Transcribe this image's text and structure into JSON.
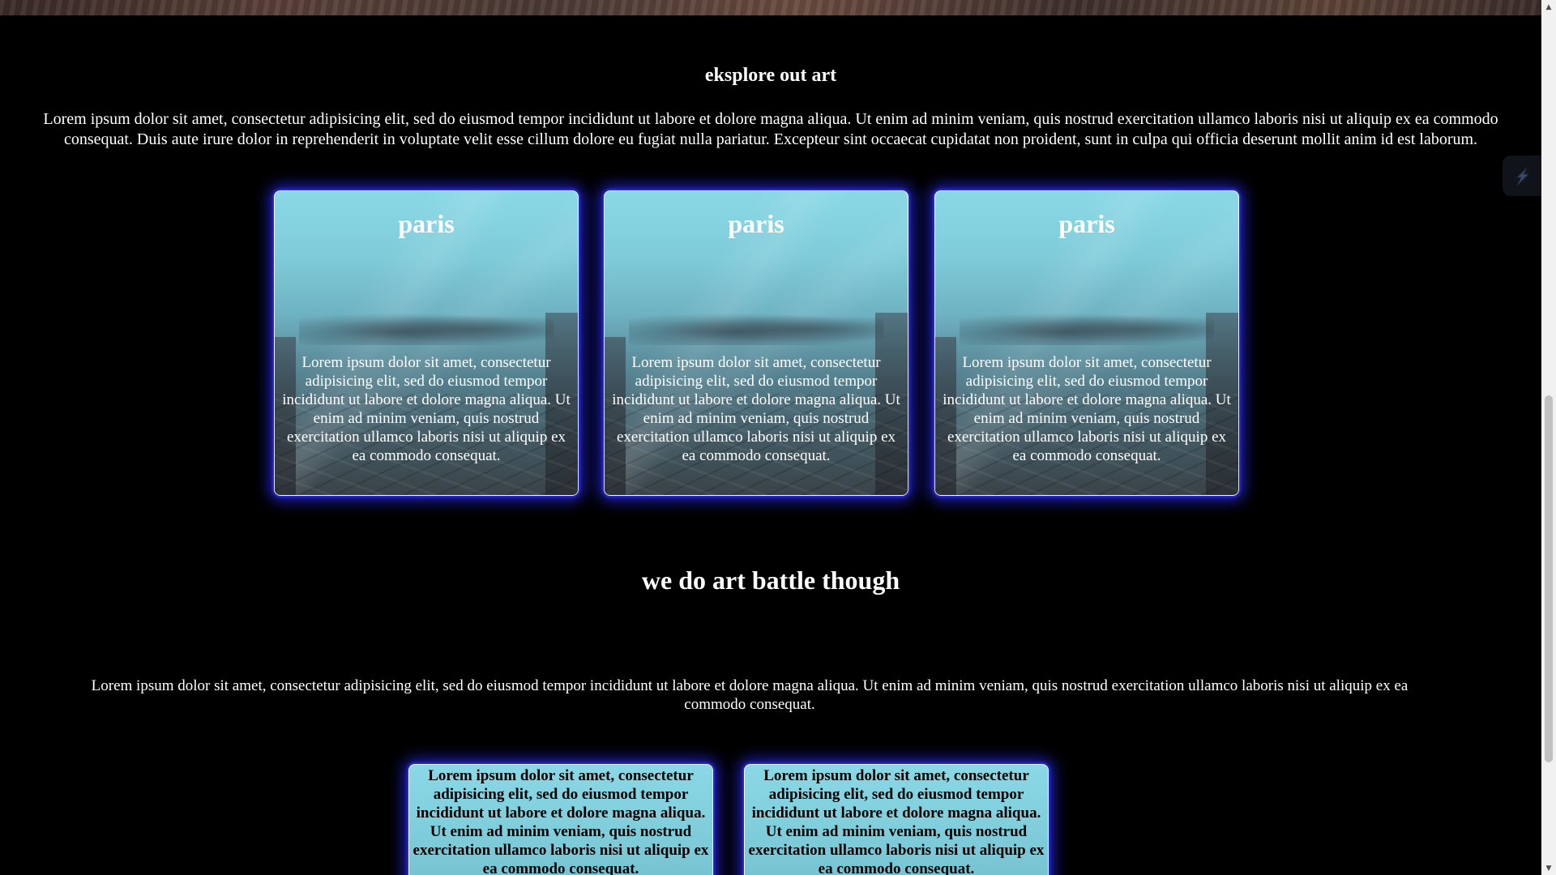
{
  "explore": {
    "title": "eksplore out art",
    "intro": "Lorem ipsum dolor sit amet, consectetur adipisicing elit, sed do eiusmod tempor incididunt ut labore et dolore magna aliqua. Ut enim ad minim veniam, quis nostrud exercitation ullamco laboris nisi ut aliquip ex ea commodo consequat. Duis aute irure dolor in reprehenderit in voluptate velit esse cillum dolore eu fugiat nulla pariatur. Excepteur sint occaecat cupidatat non proident, sunt in culpa qui officia deserunt mollit anim id est laborum.",
    "cards": [
      {
        "title": "paris",
        "body": "Lorem ipsum dolor sit amet, consectetur adipisicing elit, sed do eiusmod tempor incididunt ut labore et dolore magna aliqua. Ut enim ad minim veniam, quis nostrud exercitation ullamco laboris nisi ut aliquip ex ea commodo consequat."
      },
      {
        "title": "paris",
        "body": "Lorem ipsum dolor sit amet, consectetur adipisicing elit, sed do eiusmod tempor incididunt ut labore et dolore magna aliqua. Ut enim ad minim veniam, quis nostrud exercitation ullamco laboris nisi ut aliquip ex ea commodo consequat."
      },
      {
        "title": "paris",
        "body": "Lorem ipsum dolor sit amet, consectetur adipisicing elit, sed do eiusmod tempor incididunt ut labore et dolore magna aliqua. Ut enim ad minim veniam, quis nostrud exercitation ullamco laboris nisi ut aliquip ex ea commodo consequat."
      }
    ]
  },
  "battle": {
    "title": "we do art battle though",
    "intro": "Lorem ipsum dolor sit amet, consectetur adipisicing elit, sed do eiusmod tempor incididunt ut labore et dolore magna aliqua. Ut enim ad minim veniam, quis nostrud exercitation ullamco laboris nisi ut aliquip ex ea commodo consequat.",
    "cards": [
      {
        "text": "Lorem ipsum dolor sit amet, consectetur adipisicing elit, sed do eiusmod tempor incididunt ut labore et dolore magna aliqua. Ut enim ad minim veniam, quis nostrud exercitation ullamco laboris nisi ut aliquip ex ea commodo consequat."
      },
      {
        "text": "Lorem ipsum dolor sit amet, consectetur adipisicing elit, sed do eiusmod tempor incididunt ut labore et dolore magna aliqua. Ut enim ad minim veniam, quis nostrud exercitation ullamco laboris nisi ut aliquip ex ea commodo consequat."
      }
    ]
  },
  "icons": {
    "side_widget": "extension-bolt-icon",
    "scroll_up": "triangle-up-icon",
    "scroll_down": "triangle-down-icon"
  },
  "colors": {
    "background": "#000000",
    "card_glow": "#2828ff",
    "card_sky": "#8ad8e6"
  }
}
